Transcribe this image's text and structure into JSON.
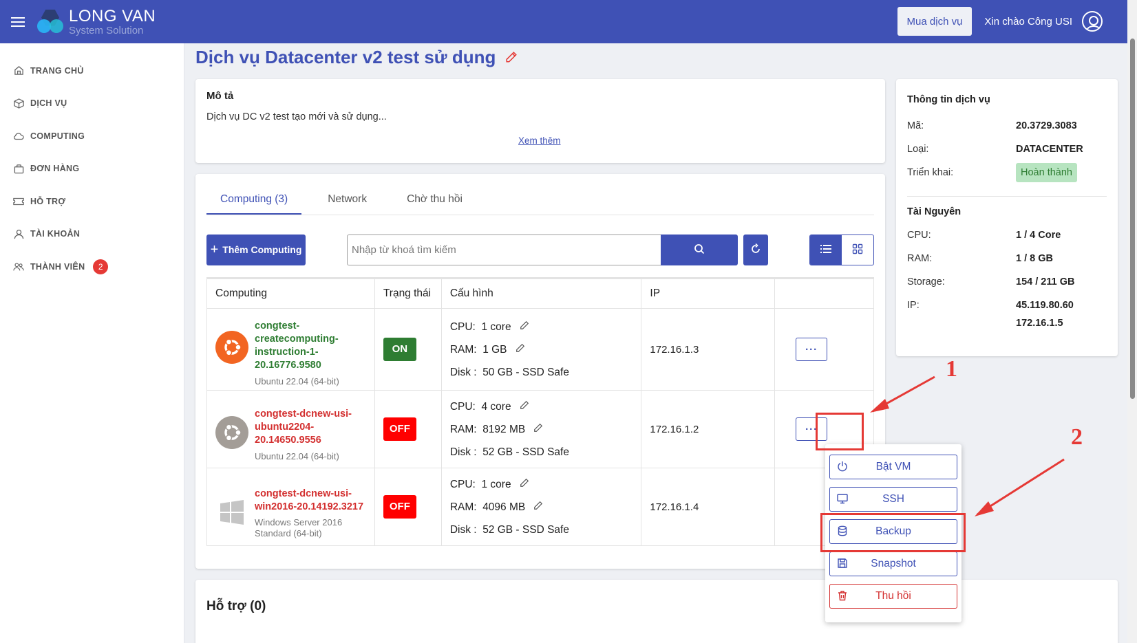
{
  "header": {
    "logo_title": "LONG VAN",
    "logo_subtitle": "System Solution",
    "buy_button": "Mua dịch vụ",
    "greeting": "Xin chào Công USI"
  },
  "sidebar": {
    "items": [
      {
        "label": "TRANG CHỦ",
        "icon": "home-icon"
      },
      {
        "label": "DỊCH VỤ",
        "icon": "cube-icon"
      },
      {
        "label": "COMPUTING",
        "icon": "cloud-icon"
      },
      {
        "label": "ĐƠN HÀNG",
        "icon": "bag-icon"
      },
      {
        "label": "HỖ TRỢ",
        "icon": "ticket-icon"
      },
      {
        "label": "TÀI KHOẢN",
        "icon": "user-icon"
      },
      {
        "label": "THÀNH VIÊN",
        "icon": "users-icon",
        "badge": "2"
      }
    ]
  },
  "page": {
    "title": "Dịch vụ Datacenter v2 test sử dụng"
  },
  "description": {
    "label": "Mô tả",
    "text": "Dịch vụ DC v2 test tạo mới và sử dụng...",
    "see_more": "Xem thêm"
  },
  "service_info": {
    "heading": "Thông tin dịch vụ",
    "code_label": "Mã:",
    "code_value": "20.3729.3083",
    "type_label": "Loại:",
    "type_value": "DATACENTER",
    "deploy_label": "Triển khai:",
    "deploy_value": "Hoàn thành",
    "resources_heading": "Tài Nguyên",
    "cpu_label": "CPU:",
    "cpu_value": "1 / 4 Core",
    "ram_label": "RAM:",
    "ram_value": "1 / 8 GB",
    "storage_label": "Storage:",
    "storage_value": "154 / 211 GB",
    "ip_label": "IP:",
    "ip_values": [
      "45.119.80.60",
      "172.16.1.5"
    ]
  },
  "tabs": [
    "Computing (3)",
    "Network",
    "Chờ thu hồi"
  ],
  "toolbar": {
    "add_button": "Thêm Computing",
    "search_placeholder": "Nhập từ khoá tìm kiếm"
  },
  "table": {
    "headers": [
      "Computing",
      "Trạng thái",
      "Cấu hình",
      "IP",
      ""
    ],
    "rows": [
      {
        "name": "congtest-createcomputing-instruction-1-20.16776.9580",
        "name_lines": [
          "congtest-",
          "createcomputing-",
          "instruction-1-",
          "20.16776.9580"
        ],
        "os": "Ubuntu 22.04 (64-bit)",
        "state": "ON",
        "cpu_label": "CPU:",
        "cpu": "1 core",
        "ram_label": "RAM:",
        "ram": "1 GB",
        "disk_label": "Disk :",
        "disk": "50 GB - SSD Safe",
        "ip": "172.16.1.3"
      },
      {
        "name_lines": [
          "congtest-dcnew-usi-",
          "ubuntu2204-",
          "20.14650.9556"
        ],
        "os": "Ubuntu 22.04 (64-bit)",
        "state": "OFF",
        "cpu_label": "CPU:",
        "cpu": "4 core",
        "ram_label": "RAM:",
        "ram": "8192 MB",
        "disk_label": "Disk :",
        "disk": "52 GB - SSD Safe",
        "ip": "172.16.1.2"
      },
      {
        "name_lines": [
          "congtest-dcnew-usi-",
          "win2016-20.14192.3217"
        ],
        "os_lines": [
          "Windows Server 2016",
          "Standard (64-bit)"
        ],
        "state": "OFF",
        "cpu_label": "CPU:",
        "cpu": "1 core",
        "ram_label": "RAM:",
        "ram": "4096 MB",
        "disk_label": "Disk :",
        "disk": "52 GB - SSD Safe",
        "ip": "172.16.1.4"
      }
    ],
    "actions_label": "···"
  },
  "action_menu": {
    "items": [
      {
        "label": "Bật VM",
        "icon": "power-icon"
      },
      {
        "label": "SSH",
        "icon": "monitor-icon"
      },
      {
        "label": "Backup",
        "icon": "database-icon"
      },
      {
        "label": "Snapshot",
        "icon": "save-icon"
      },
      {
        "label": "Thu hồi",
        "icon": "trash-icon"
      }
    ]
  },
  "support": {
    "title": "Hỗ trợ (0)"
  },
  "annotations": {
    "step1": "1",
    "step2": "2"
  },
  "colors": {
    "primary": "#3f51b5",
    "on": "#2e7d32",
    "off": "#ff0000",
    "annotation": "#e53935"
  }
}
